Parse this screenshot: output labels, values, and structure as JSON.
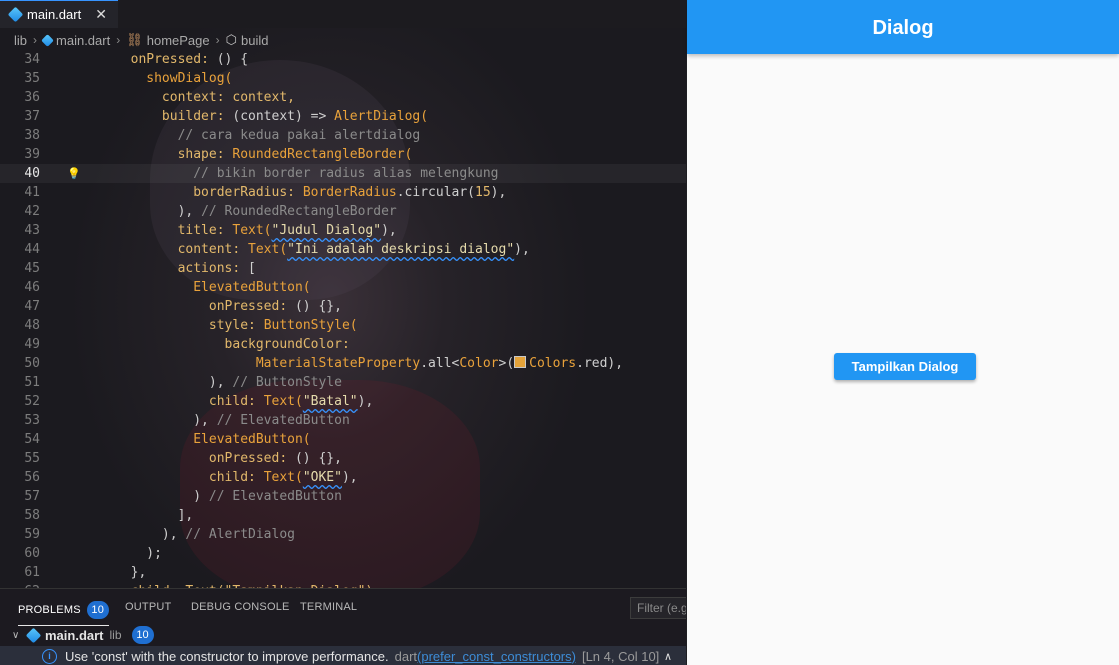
{
  "editor": {
    "tab": {
      "label": "main.dart",
      "close": "✕"
    },
    "breadcrumb": [
      "lib",
      "main.dart",
      "homePage",
      "build"
    ],
    "current_line": 40,
    "lines": [
      {
        "n": "34",
        "segs": [
          [
            "        ",
            "p"
          ],
          [
            "onPressed: ",
            "prop"
          ],
          [
            "() {",
            "pun"
          ]
        ]
      },
      {
        "n": "35",
        "segs": [
          [
            "          ",
            "p"
          ],
          [
            "showDialog(",
            "class"
          ]
        ]
      },
      {
        "n": "36",
        "segs": [
          [
            "            ",
            "p"
          ],
          [
            "context: ",
            "prop"
          ],
          [
            "context,",
            "prop"
          ]
        ]
      },
      {
        "n": "37",
        "segs": [
          [
            "            ",
            "p"
          ],
          [
            "builder: ",
            "prop"
          ],
          [
            "(context) => ",
            "pun"
          ],
          [
            "AlertDialog(",
            "class"
          ]
        ]
      },
      {
        "n": "38",
        "segs": [
          [
            "              ",
            "p"
          ],
          [
            "// cara kedua pakai alertdialog",
            "com"
          ]
        ]
      },
      {
        "n": "39",
        "segs": [
          [
            "              ",
            "p"
          ],
          [
            "shape: ",
            "prop"
          ],
          [
            "RoundedRectangleBorder(",
            "class"
          ]
        ]
      },
      {
        "n": "40",
        "segs": [
          [
            "                ",
            "p"
          ],
          [
            "// bikin border radius alias melengkung",
            "com"
          ]
        ]
      },
      {
        "n": "41",
        "segs": [
          [
            "                ",
            "p"
          ],
          [
            "borderRadius: ",
            "prop"
          ],
          [
            "BorderRadius",
            "class"
          ],
          [
            ".circular(",
            "pun"
          ],
          [
            "15",
            "num"
          ],
          [
            "),",
            "pun"
          ]
        ]
      },
      {
        "n": "42",
        "segs": [
          [
            "              ",
            "p"
          ],
          [
            "), ",
            "pun"
          ],
          [
            "// RoundedRectangleBorder",
            "com"
          ]
        ]
      },
      {
        "n": "43",
        "segs": [
          [
            "              ",
            "p"
          ],
          [
            "title: ",
            "prop"
          ],
          [
            "Text(",
            "class"
          ],
          [
            "\"Judul Dialog\"",
            "str"
          ],
          [
            "),",
            "pun"
          ]
        ]
      },
      {
        "n": "44",
        "segs": [
          [
            "              ",
            "p"
          ],
          [
            "content: ",
            "prop"
          ],
          [
            "Text(",
            "class"
          ],
          [
            "\"Ini adalah deskripsi dialog\"",
            "str"
          ],
          [
            "),",
            "pun"
          ]
        ]
      },
      {
        "n": "45",
        "segs": [
          [
            "              ",
            "p"
          ],
          [
            "actions: ",
            "prop"
          ],
          [
            "[",
            "pun"
          ]
        ]
      },
      {
        "n": "46",
        "segs": [
          [
            "                ",
            "p"
          ],
          [
            "ElevatedButton(",
            "class"
          ]
        ]
      },
      {
        "n": "47",
        "segs": [
          [
            "                  ",
            "p"
          ],
          [
            "onPressed: ",
            "prop"
          ],
          [
            "() {},",
            "pun"
          ]
        ]
      },
      {
        "n": "48",
        "segs": [
          [
            "                  ",
            "p"
          ],
          [
            "style: ",
            "prop"
          ],
          [
            "ButtonStyle(",
            "class"
          ]
        ]
      },
      {
        "n": "49",
        "segs": [
          [
            "                    ",
            "p"
          ],
          [
            "backgroundColor:",
            "prop"
          ]
        ]
      },
      {
        "n": "50",
        "segs": [
          [
            "                        ",
            "p"
          ],
          [
            "MaterialStateProperty",
            "class"
          ],
          [
            ".all<",
            "pun"
          ],
          [
            "Color",
            "class"
          ],
          [
            ">(",
            "pun"
          ],
          [
            "SW",
            "swatch"
          ],
          [
            "Colors",
            "class"
          ],
          [
            ".red),",
            "pun"
          ]
        ]
      },
      {
        "n": "51",
        "segs": [
          [
            "                  ",
            "p"
          ],
          [
            "), ",
            "pun"
          ],
          [
            "// ButtonStyle",
            "com"
          ]
        ]
      },
      {
        "n": "52",
        "segs": [
          [
            "                  ",
            "p"
          ],
          [
            "child: ",
            "prop"
          ],
          [
            "Text(",
            "class"
          ],
          [
            "\"Batal\"",
            "str"
          ],
          [
            "),",
            "pun"
          ]
        ]
      },
      {
        "n": "53",
        "segs": [
          [
            "                ",
            "p"
          ],
          [
            "), ",
            "pun"
          ],
          [
            "// ElevatedButton",
            "com"
          ]
        ]
      },
      {
        "n": "54",
        "segs": [
          [
            "                ",
            "p"
          ],
          [
            "ElevatedButton(",
            "class"
          ]
        ]
      },
      {
        "n": "55",
        "segs": [
          [
            "                  ",
            "p"
          ],
          [
            "onPressed: ",
            "prop"
          ],
          [
            "() {},",
            "pun"
          ]
        ]
      },
      {
        "n": "56",
        "segs": [
          [
            "                  ",
            "p"
          ],
          [
            "child: ",
            "prop"
          ],
          [
            "Text(",
            "class"
          ],
          [
            "\"OKE\"",
            "str"
          ],
          [
            "),",
            "pun"
          ]
        ]
      },
      {
        "n": "57",
        "segs": [
          [
            "                ",
            "p"
          ],
          [
            ") ",
            "pun"
          ],
          [
            "// ElevatedButton",
            "com"
          ]
        ]
      },
      {
        "n": "58",
        "segs": [
          [
            "              ",
            "p"
          ],
          [
            "],",
            "pun"
          ]
        ]
      },
      {
        "n": "59",
        "segs": [
          [
            "            ",
            "p"
          ],
          [
            "), ",
            "pun"
          ],
          [
            "// AlertDialog",
            "com"
          ]
        ]
      },
      {
        "n": "60",
        "segs": [
          [
            "          ",
            "p"
          ],
          [
            ");",
            "pun"
          ]
        ]
      },
      {
        "n": "61",
        "segs": [
          [
            "        ",
            "p"
          ],
          [
            "},",
            "pun"
          ]
        ]
      },
      {
        "n": "62",
        "segs": [
          [
            "        ",
            "p"
          ],
          [
            "child: Text(\"Tampilkan Dialog\"),",
            "prop"
          ]
        ]
      }
    ]
  },
  "panel": {
    "tabs": [
      "PROBLEMS",
      "OUTPUT",
      "DEBUG CONSOLE",
      "TERMINAL"
    ],
    "problem_count": "10",
    "filter_placeholder": "Filter (e.g.",
    "file": {
      "name": "main.dart",
      "dir": "lib",
      "count": "10"
    },
    "problem": {
      "message": "Use 'const' with the constructor to improve performance.",
      "source": "dart",
      "code": "(prefer_const_constructors)",
      "location": "[Ln 4, Col 10]"
    }
  },
  "app": {
    "title": "Dialog",
    "button_label": "Tampilkan Dialog",
    "colors": {
      "primary": "#2196f3",
      "background": "#fafafa"
    }
  }
}
